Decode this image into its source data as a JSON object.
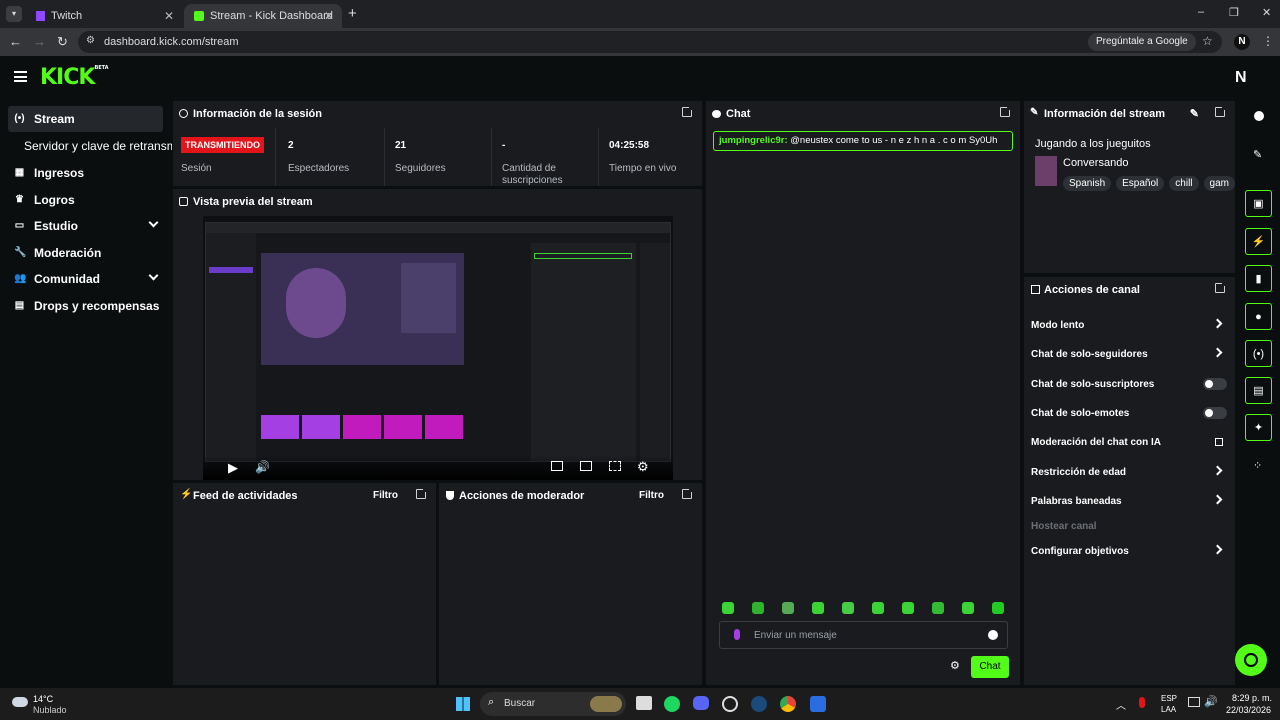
{
  "browser": {
    "tabs": [
      {
        "label": "Twitch"
      },
      {
        "label": "Stream - Kick Dashboard"
      }
    ],
    "new_tab": "+",
    "url": "dashboard.kick.com/stream",
    "ask_google": "Pregúntale a Google",
    "profile_initial": "N"
  },
  "app": {
    "logo": "KICK",
    "logo_beta": "BETA",
    "user_initial": "N"
  },
  "sidebar": {
    "items": [
      {
        "label": "Stream",
        "icon": "broadcast-icon"
      },
      {
        "label": "Servidor y clave de retransmisión"
      },
      {
        "label": "Ingresos",
        "icon": "chart-icon"
      },
      {
        "label": "Logros",
        "icon": "trophy-icon"
      },
      {
        "label": "Estudio",
        "icon": "studio-icon"
      },
      {
        "label": "Moderación",
        "icon": "wrench-icon"
      },
      {
        "label": "Comunidad",
        "icon": "community-icon"
      },
      {
        "label": "Drops y recompensas",
        "icon": "drops-icon"
      }
    ]
  },
  "session": {
    "title": "Información de la sesión",
    "live_badge": "TRANSMITIENDO",
    "live_label": "Sesión",
    "stats": [
      {
        "value": "2",
        "label": "Espectadores"
      },
      {
        "value": "21",
        "label": "Seguidores"
      },
      {
        "value": "-",
        "label": "Cantidad de suscripciones"
      },
      {
        "value": "04:25:58",
        "label": "Tiempo en vivo"
      }
    ]
  },
  "preview": {
    "title": "Vista previa del stream"
  },
  "activity": {
    "title": "Feed de actividades",
    "filter": "Filtro"
  },
  "modactions": {
    "title": "Acciones de moderador",
    "filter": "Filtro"
  },
  "chat": {
    "title": "Chat",
    "message": {
      "user": "jumpingrelic9r:",
      "text": "@neustex come to us - n e z h n a . c o m Sy0Uh"
    },
    "input_placeholder": "Enviar un mensaje",
    "send": "Chat"
  },
  "stream_info": {
    "title": "Información del stream",
    "stream_title": "Jugando a los jueguitos",
    "category": "Conversando",
    "tags": [
      "Spanish",
      "Español",
      "chill",
      "gam"
    ]
  },
  "channel_actions": {
    "title": "Acciones de canal",
    "items": [
      {
        "label": "Modo lento"
      },
      {
        "label": "Chat de solo-seguidores"
      },
      {
        "label": "Chat de solo-suscriptores"
      },
      {
        "label": "Chat de solo-emotes"
      },
      {
        "label": "Moderación del chat con IA"
      },
      {
        "label": "Restricción de edad"
      },
      {
        "label": "Palabras baneadas"
      },
      {
        "label": "Hostear canal"
      },
      {
        "label": "Configurar objetivos"
      }
    ]
  },
  "taskbar": {
    "weather_temp": "14°C",
    "weather_desc": "Nublado",
    "search": "Buscar",
    "lang": "ESP",
    "lang2": "LAA",
    "time": "8:29 p. m.",
    "date": "22/03/2026"
  },
  "colors": {
    "accent": "#53fc18",
    "live": "#e3151a"
  }
}
